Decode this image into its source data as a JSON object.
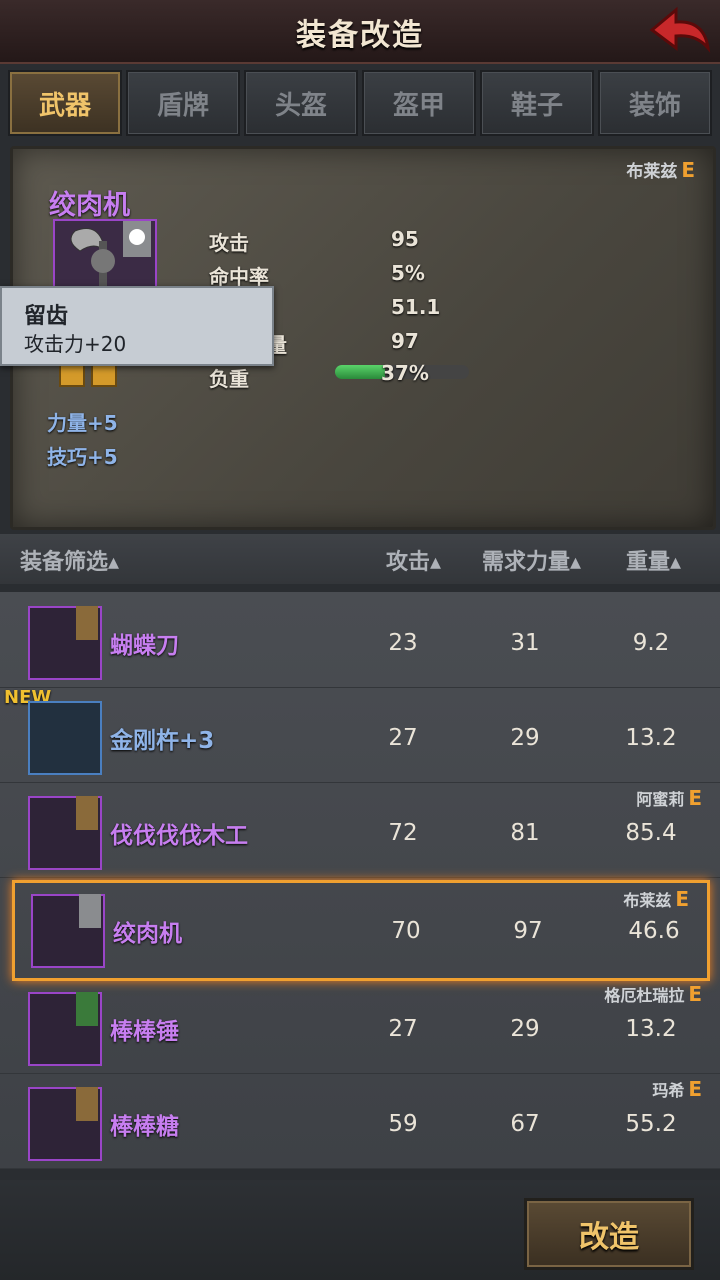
{
  "title": "装备改造",
  "tabs": [
    {
      "label": "武器",
      "active": true
    },
    {
      "label": "盾牌",
      "active": false
    },
    {
      "label": "头盔",
      "active": false
    },
    {
      "label": "盔甲",
      "active": false
    },
    {
      "label": "鞋子",
      "active": false
    },
    {
      "label": "装饰",
      "active": false
    }
  ],
  "detail": {
    "owner": "布莱兹",
    "owner_grade": "E",
    "name": "绞肉机",
    "stats": [
      {
        "label": "攻击",
        "value": "95"
      },
      {
        "label": "命中率",
        "value": "5%"
      },
      {
        "label": "",
        "value": "51.1"
      },
      {
        "label": "量",
        "value": "97"
      },
      {
        "label": "负重",
        "value": "37%"
      }
    ],
    "weight_percent": 37,
    "bonuses": [
      "力量+5",
      "技巧+5"
    ]
  },
  "tooltip": {
    "title": "留齿",
    "text": "攻击力+20"
  },
  "list_header": {
    "name": "装备筛选",
    "attack": "攻击",
    "strength": "需求力量",
    "weight": "重量"
  },
  "items": [
    {
      "name": "蝴蝶刀",
      "plus": "",
      "attack": "23",
      "strength": "31",
      "weight": "9.2",
      "owner": "",
      "grade": "",
      "new": "",
      "icon": "dagger-icon",
      "badge": "bronze",
      "color": "purple"
    },
    {
      "name": "金刚杵",
      "plus": "+3",
      "attack": "27",
      "strength": "29",
      "weight": "13.2",
      "owner": "",
      "grade": "",
      "new": "NEW",
      "icon": "mace-icon",
      "badge": "",
      "color": "blue"
    },
    {
      "name": "伐伐伐伐木工",
      "plus": "",
      "attack": "72",
      "strength": "81",
      "weight": "85.4",
      "owner": "阿蜜莉",
      "grade": "E",
      "new": "",
      "icon": "greatsword-icon",
      "badge": "bronze",
      "color": "purple"
    },
    {
      "name": "绞肉机",
      "plus": "",
      "attack": "70",
      "strength": "97",
      "weight": "46.6",
      "owner": "布莱兹",
      "grade": "E",
      "new": "",
      "icon": "axe-icon",
      "badge": "gray",
      "color": "purple",
      "selected": true
    },
    {
      "name": "棒棒锤",
      "plus": "",
      "attack": "27",
      "strength": "29",
      "weight": "13.2",
      "owner": "格厄杜瑞拉",
      "grade": "E",
      "new": "",
      "icon": "hammer-icon",
      "badge": "green",
      "color": "purple"
    },
    {
      "name": "棒棒糖",
      "plus": "",
      "attack": "59",
      "strength": "67",
      "weight": "55.2",
      "owner": "玛希",
      "grade": "E",
      "new": "",
      "icon": "spiked-mace-icon",
      "badge": "bronze",
      "color": "purple"
    }
  ],
  "action_button": "改造"
}
